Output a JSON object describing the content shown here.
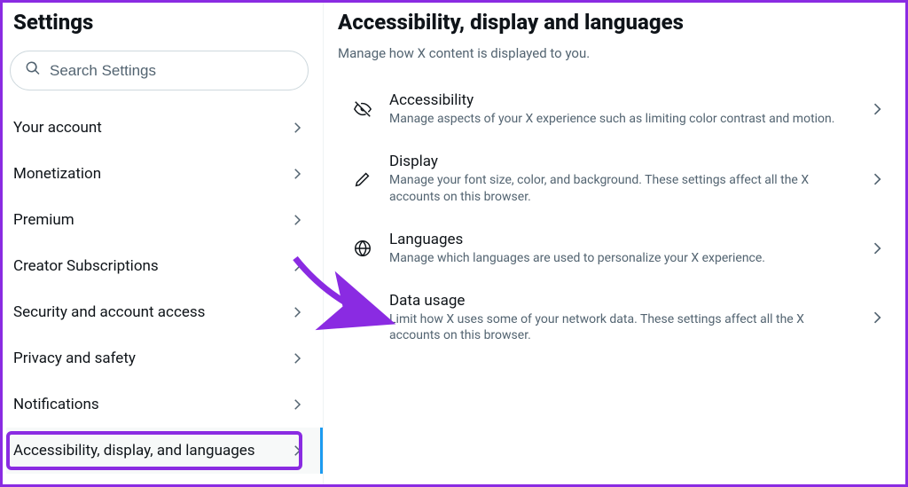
{
  "sidebar": {
    "header": "Settings",
    "search_placeholder": "Search Settings",
    "items": [
      {
        "label": "Your account"
      },
      {
        "label": "Monetization"
      },
      {
        "label": "Premium"
      },
      {
        "label": "Creator Subscriptions"
      },
      {
        "label": "Security and account access"
      },
      {
        "label": "Privacy and safety"
      },
      {
        "label": "Notifications"
      },
      {
        "label": "Accessibility, display, and languages"
      }
    ]
  },
  "main": {
    "title": "Accessibility, display and languages",
    "subtitle": "Manage how X content is displayed to you.",
    "options": [
      {
        "title": "Accessibility",
        "desc": "Manage aspects of your X experience such as limiting color contrast and motion."
      },
      {
        "title": "Display",
        "desc": "Manage your font size, color, and background. These settings affect all the X accounts on this browser."
      },
      {
        "title": "Languages",
        "desc": "Manage which languages are used to personalize your X experience."
      },
      {
        "title": "Data usage",
        "desc": "Limit how X uses some of your network data. These settings affect all the X accounts on this browser."
      }
    ]
  },
  "annotation": {
    "color": "#8a2be2"
  }
}
